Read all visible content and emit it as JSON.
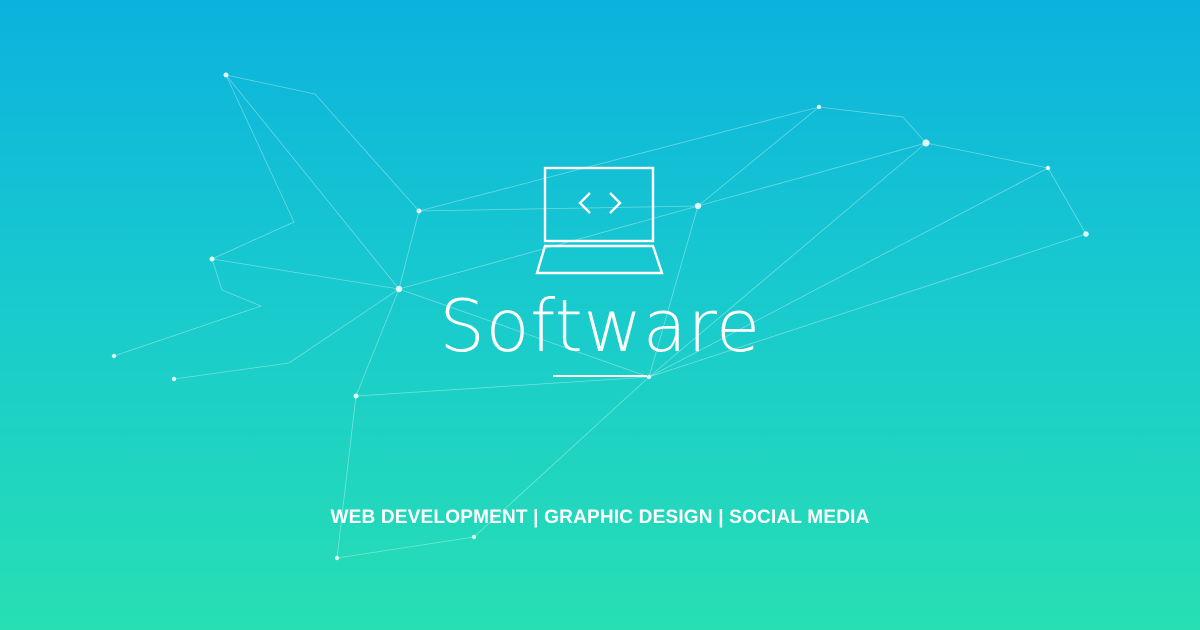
{
  "banner": {
    "title": "Software",
    "tagline": "WEB DEVELOPMENT | GRAPHIC DESIGN | SOCIAL MEDIA",
    "icon": "laptop-code-icon",
    "code_glyph": "<>",
    "colors": {
      "gradient_top": "#0bb2de",
      "gradient_bottom": "#27dfb3",
      "foreground": "#ffffff"
    }
  }
}
